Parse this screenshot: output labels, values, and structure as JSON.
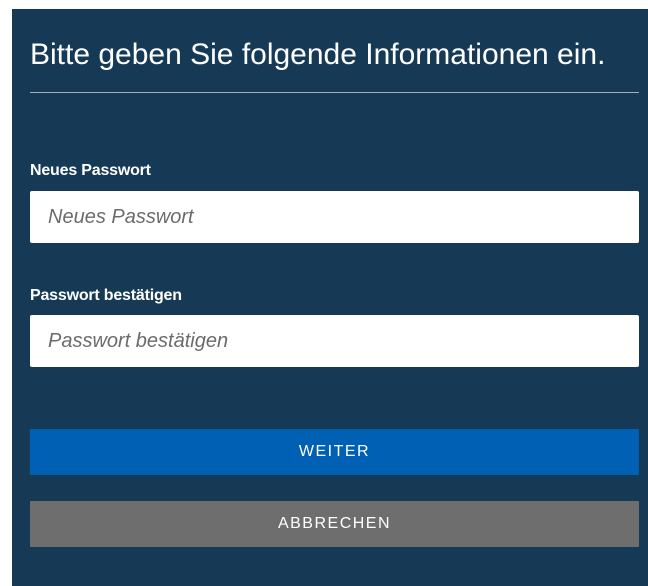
{
  "form": {
    "heading": "Bitte geben Sie folgende Informationen ein.",
    "new_password": {
      "label": "Neues Passwort",
      "placeholder": "Neues Passwort",
      "value": ""
    },
    "confirm_password": {
      "label": "Passwort bestätigen",
      "placeholder": "Passwort bestätigen",
      "value": ""
    },
    "continue_label": "WEITER",
    "cancel_label": "ABBRECHEN"
  },
  "colors": {
    "panel_background": "#163a56",
    "primary_button": "#0061b4",
    "secondary_button": "#6e6e6e",
    "input_background": "#ffffff"
  }
}
